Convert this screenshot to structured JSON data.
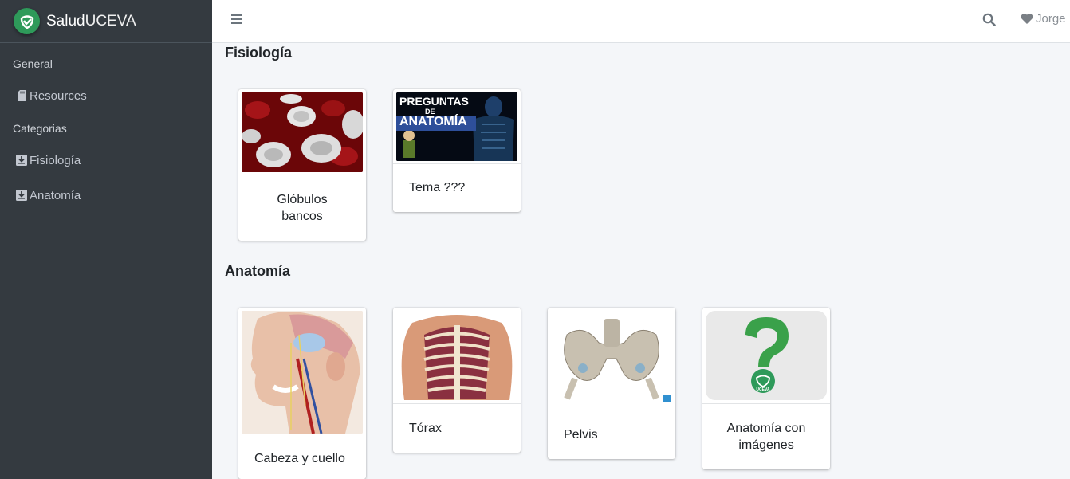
{
  "brand": {
    "name_a": "Salud",
    "name_b": "UCEVA"
  },
  "sidebar": {
    "header_general": "General",
    "resources": "Resources",
    "header_categories": "Categorias",
    "fisiologia": "Fisiología",
    "anatomia": "Anatomía"
  },
  "topbar": {
    "user_name": "Jorge"
  },
  "sections": {
    "fisiologia": {
      "title": "Fisiología",
      "cards": [
        {
          "label_line1": "Glóbulos",
          "label_line2": "bancos"
        },
        {
          "label": "Tema ???",
          "thumb_title1": "PREGUNTAS",
          "thumb_title2": "DE",
          "thumb_title3": "ANATOMÍA"
        }
      ]
    },
    "anatomia": {
      "title": "Anatomía",
      "cards": [
        {
          "label": "Cabeza y cuello"
        },
        {
          "label": "Tórax"
        },
        {
          "label": "Pelvis"
        },
        {
          "label_line1": "Anatomía con",
          "label_line2": "imágenes",
          "logo_text": "UCEVA"
        }
      ]
    }
  },
  "colors": {
    "sidebar_bg": "#343a40",
    "brand_green": "#2e9a5a",
    "question_green": "#3aa14a"
  }
}
